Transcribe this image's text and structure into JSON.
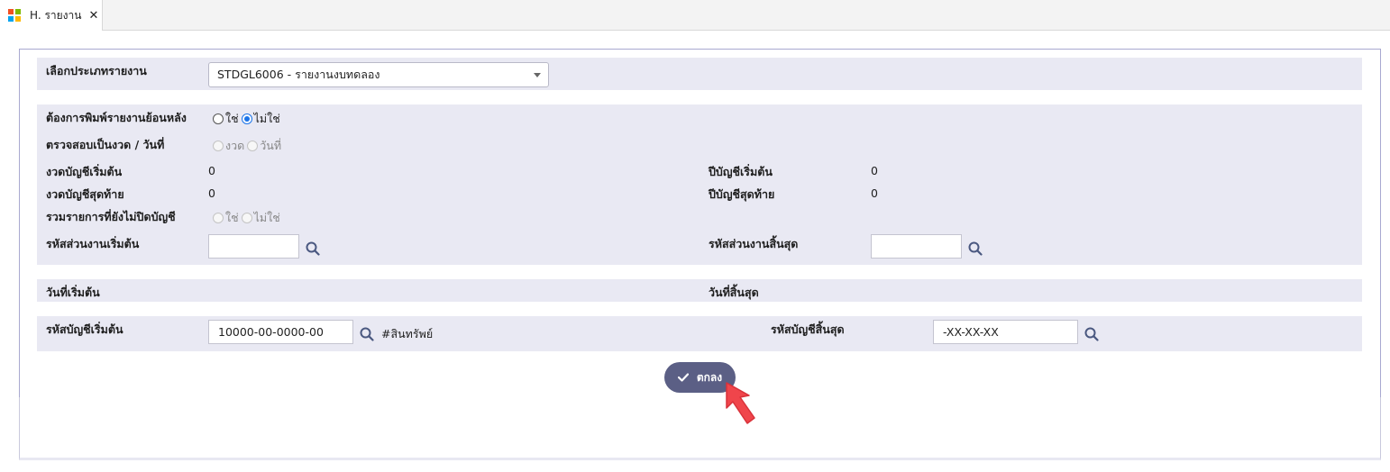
{
  "tab": {
    "label": "H. รายงาน",
    "close": "✕",
    "icon": "windows-logo-icon",
    "icon_colors": [
      "#f25022",
      "#7fba00",
      "#00a4ef",
      "#ffb900"
    ]
  },
  "report_type": {
    "label": "เลือกประเภทรายงาน",
    "selected": "STDGL6006 - รายงานงบทดลอง"
  },
  "form": {
    "print_backdated": {
      "label": "ต้องการพิมพ์รายงานย้อนหลัง",
      "options": [
        "ใช่",
        "ไม่ใช่"
      ],
      "selected": "ไม่ใช่"
    },
    "check_by": {
      "label": "ตรวจสอบเป็นงวด / วันที่",
      "options": [
        "งวด",
        "วันที่"
      ]
    },
    "start_period": {
      "label": "งวดบัญชีเริ่มต้น",
      "value": "0"
    },
    "end_period": {
      "label": "งวดบัญชีสุดท้าย",
      "value": "0"
    },
    "start_year": {
      "label": "ปีบัญชีเริ่มต้น",
      "value": "0"
    },
    "end_year": {
      "label": "ปีบัญชีสุดท้าย",
      "value": "0"
    },
    "include_unclosed": {
      "label": "รวมรายการที่ยังไม่ปิดบัญชี",
      "options": [
        "ใช่",
        "ไม่ใช่"
      ]
    },
    "dept_start": {
      "label": "รหัสส่วนงานเริ่มต้น",
      "value": ""
    },
    "dept_end": {
      "label": "รหัสส่วนงานสิ้นสุด",
      "value": ""
    }
  },
  "dates": {
    "start_label": "วันที่เริ่มต้น",
    "end_label": "วันที่สิ้นสุด"
  },
  "accounts": {
    "start_label": "รหัสบัญชีเริ่มต้น",
    "start_value": "10000-00-0000-00",
    "start_desc": "#สินทรัพย์",
    "end_label": "รหัสบัญชีสิ้นสุด",
    "end_value": "-XX-XX-XX"
  },
  "ok_button": {
    "label": "ตกลง"
  },
  "colors": {
    "button_bg": "#5b5f85",
    "block_bg": "#e9e9f3",
    "radio_accent": "#1a73e8",
    "cursor": "#f0454b"
  }
}
